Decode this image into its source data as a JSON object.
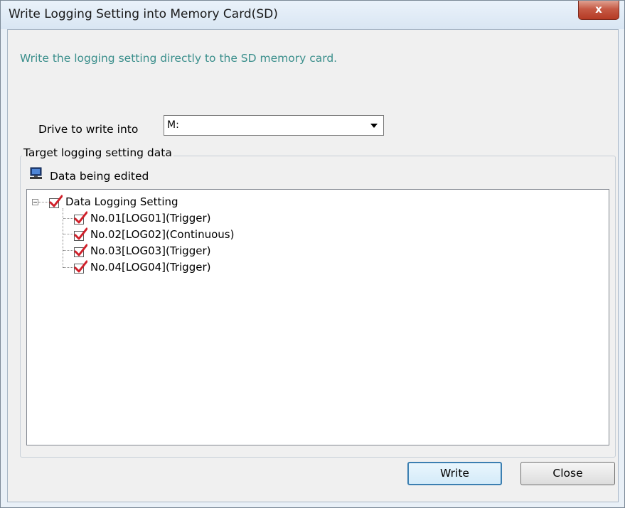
{
  "window": {
    "title": "Write Logging Setting into Memory Card(SD)",
    "close_glyph": "x"
  },
  "description": "Write the logging setting directly to the SD memory card.",
  "drive": {
    "label": "Drive to write into",
    "selected": "M:"
  },
  "target_group": {
    "label": "Target logging setting data",
    "source_label": "Data being edited",
    "tree": {
      "root": {
        "label": "Data Logging Setting",
        "checked": true,
        "expanded": true
      },
      "children": [
        {
          "label": "No.01[LOG01](Trigger)",
          "checked": true
        },
        {
          "label": "No.02[LOG02](Continuous)",
          "checked": true
        },
        {
          "label": "No.03[LOG03](Trigger)",
          "checked": true
        },
        {
          "label": "No.04[LOG04](Trigger)",
          "checked": true
        }
      ]
    }
  },
  "buttons": {
    "write": "Write",
    "close": "Close"
  },
  "colors": {
    "description_text": "#3b8f8c",
    "check_mark": "#d0202a",
    "default_button_border": "#3c7fb1"
  }
}
